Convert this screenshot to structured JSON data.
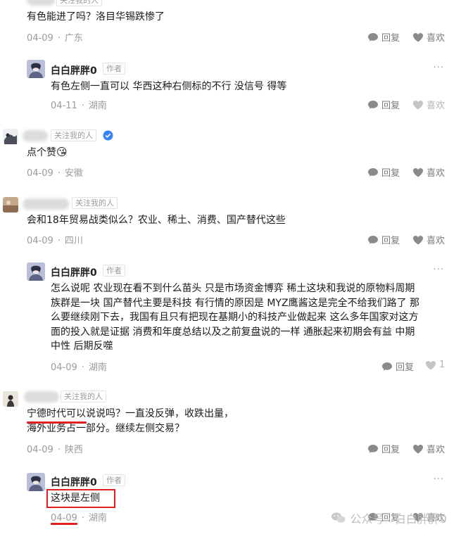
{
  "top_comment": {
    "fan_tag": "关注我的人",
    "text": "有色能进了吗？洛目华锡跌惨了",
    "date": "04-09",
    "location": "广东",
    "reply_label": "回复",
    "like_label": "喜欢"
  },
  "reply1": {
    "name": "白白胖胖0",
    "author_tag": "作者",
    "text": "有色左侧一直可以 华西这种右侧标的不行 没信号 得等",
    "date": "04-11",
    "location": "湖南",
    "reply_label": "回复",
    "like_label": "喜欢"
  },
  "comment2": {
    "fan_tag": "关注我的人",
    "text": "点个赞",
    "emoji": "😘",
    "date": "04-09",
    "location": "安徽",
    "reply_label": "回复",
    "like_label": "喜欢"
  },
  "comment3": {
    "fan_tag": "关注我的人",
    "text": "会和18年贸易战类似么？农业、稀土、消费、国产替代这些",
    "date": "04-09",
    "location": "四川",
    "reply_label": "回复",
    "like_label": "喜欢"
  },
  "reply3": {
    "name": "白白胖胖0",
    "author_tag": "作者",
    "lines": [
      "怎么说呢 农业现在看不到什么苗头 只是市场资金博弈 稀土这块和我说的原物料周期",
      "族群是一块 国产替代主要是科技 有行情的原因是 MYZ鹰酱这是完全不给我们路了 那",
      "么要继续刚下去，我国有且只有把现在基期小的科技产业做起来 这么多年国家对这方",
      "面的投入就是证据 消费和年度总结以及之前复盘说的一样 通胀起来初期会有益 中期",
      "中性 后期反噬"
    ],
    "date": "04-09",
    "location": "湖南",
    "reply_label": "回复",
    "like_count": "1"
  },
  "comment4": {
    "fan_tag": "关注我的人",
    "lines": [
      "宁德时代可以说说吗？一直没反弹，收跌出量，",
      "海外业务占一部分。继续左侧交易？"
    ],
    "date": "04-09",
    "location": "陕西",
    "reply_label": "回复",
    "like_label": "喜欢"
  },
  "reply4": {
    "name": "白白胖胖0",
    "author_tag": "作者",
    "text": "这块是左侧",
    "date": "04-09",
    "location": "湖南",
    "reply_label": "回复",
    "like_label": "喜欢"
  },
  "watermark": "公众号 · 白白胖胖0",
  "colors": {
    "highlight": "#e02020",
    "verified": "#3b82f6",
    "meta": "#9a9a9a"
  },
  "icons": [
    "chat-bubble-icon",
    "heart-icon",
    "more-icon",
    "verified-icon",
    "wechat-icon"
  ]
}
